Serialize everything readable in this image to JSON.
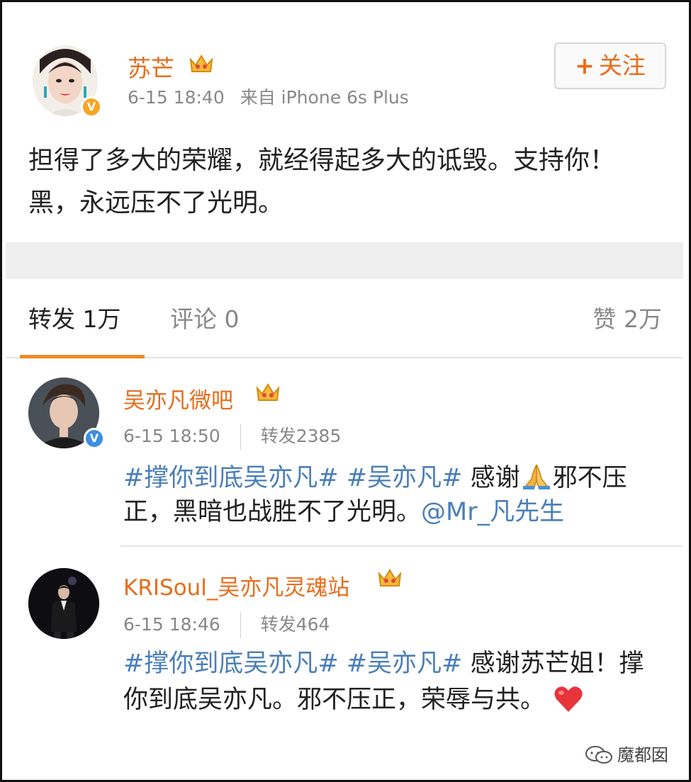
{
  "post": {
    "author": "苏芒",
    "time": "6-15 18:40",
    "source": "来自 iPhone 6s Plus",
    "follow_label": "关注",
    "follow_plus": "+",
    "verified_mark": "V",
    "text": "担得了多大的荣耀，就经得起多大的诋毁。支持你！黑，永远压不了光明。"
  },
  "tabs": {
    "reposts": "转发 1万",
    "comments": "评论 0",
    "likes": "赞 2万"
  },
  "comments": [
    {
      "name": "吴亦凡微吧",
      "time": "6-15 18:50",
      "reposts": "转发2385",
      "verified_mark": "V",
      "tag1": "#撑你到底吴亦凡#",
      "tag2": "#吴亦凡#",
      "text_a": "感谢",
      "text_b": "邪不压正，黑暗也战胜不了光明。",
      "mention": "@Mr_凡先生"
    },
    {
      "name": "KRISoul_吴亦凡灵魂站",
      "time": "6-15 18:46",
      "reposts": "转发464",
      "tag1": "#撑你到底吴亦凡#",
      "tag2": "#吴亦凡#",
      "text_a": "感谢苏芒姐！撑你到底吴亦凡。邪不压正，荣辱与共。"
    }
  ],
  "watermark": "魔都囡",
  "icons": {
    "crown": "crown-icon",
    "verified": "verified-icon",
    "pray": "pray-emoji-icon",
    "heart": "heart-emoji-icon",
    "wechat": "wechat-icon"
  },
  "colors": {
    "name_orange": "#e86c1a",
    "link_blue": "#4a7fb8",
    "tab_underline": "#f08a24",
    "verified_gold": "#f5a623",
    "verified_blue": "#3d8fe0"
  }
}
